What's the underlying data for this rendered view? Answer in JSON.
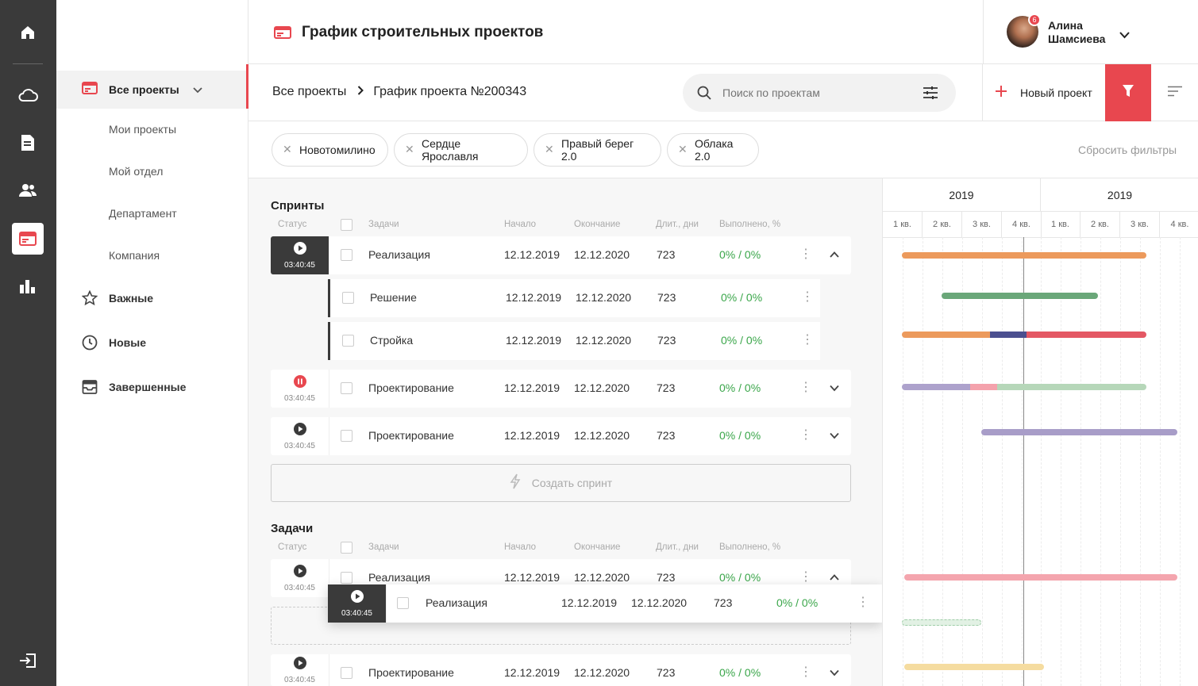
{
  "header": {
    "title": "График строительных проектов"
  },
  "user": {
    "first_name": "Алина",
    "last_name": "Шамсиева",
    "notifications": "6"
  },
  "nav": {
    "all_projects": "Все проекты",
    "my_projects": "Мои проекты",
    "my_department": "Мой отдел",
    "department": "Департамент",
    "company": "Компания",
    "important": "Важные",
    "new": "Новые",
    "completed": "Завершенные"
  },
  "breadcrumb": {
    "root": "Все проекты",
    "current": "График проекта №200343"
  },
  "search": {
    "placeholder": "Поиск по проектам"
  },
  "toolbar": {
    "new_project": "Новый проект",
    "reset_filters": "Сбросить фильтры"
  },
  "filters": [
    "Новотомилино",
    "Сердце Ярославля",
    "Правый берег 2.0",
    "Облака 2.0"
  ],
  "columns": {
    "status": "Статус",
    "tasks": "Задачи",
    "start": "Начало",
    "end": "Окончание",
    "duration": "Длит., дни",
    "done": "Выполнено, %"
  },
  "sprints": {
    "title": "Спринты",
    "rows": [
      {
        "time": "03:40:45",
        "name": "Реализация",
        "start": "12.12.2019",
        "end": "12.12.2020",
        "dur": "723",
        "done": "0% / 0%"
      },
      {
        "name": "Решение",
        "start": "12.12.2019",
        "end": "12.12.2020",
        "dur": "723",
        "done": "0% / 0%"
      },
      {
        "name": "Стройка",
        "start": "12.12.2019",
        "end": "12.12.2020",
        "dur": "723",
        "done": "0% / 0%"
      },
      {
        "time": "03:40:45",
        "name": "Проектирование",
        "start": "12.12.2019",
        "end": "12.12.2020",
        "dur": "723",
        "done": "0% / 0%"
      },
      {
        "time": "03:40:45",
        "name": "Проектирование",
        "start": "12.12.2019",
        "end": "12.12.2020",
        "dur": "723",
        "done": "0% / 0%"
      }
    ],
    "create": "Создать спринт"
  },
  "tasks": {
    "title": "Задачи",
    "rows": [
      {
        "time": "03:40:45",
        "name": "Реализация",
        "start": "12.12.2019",
        "end": "12.12.2020",
        "dur": "723",
        "done": "0% / 0%"
      },
      {
        "time": "03:40:45",
        "name": "Реализация",
        "start": "12.12.2019",
        "end": "12.12.2020",
        "dur": "723",
        "done": "0% / 0%"
      },
      {
        "time": "03:40:45",
        "name": "Проектирование",
        "start": "12.12.2019",
        "end": "12.12.2020",
        "dur": "723",
        "done": "0% / 0%"
      }
    ]
  },
  "gantt": {
    "years": [
      "2019",
      "2019"
    ],
    "quarters": [
      "1 кв.",
      "2 кв.",
      "3 кв.",
      "4 кв.",
      "1 кв.",
      "2 кв.",
      "3 кв.",
      "4 кв."
    ]
  },
  "colors": {
    "accent": "#e8474f",
    "sidebar": "#3a3a3a",
    "success": "#3aa64a"
  }
}
